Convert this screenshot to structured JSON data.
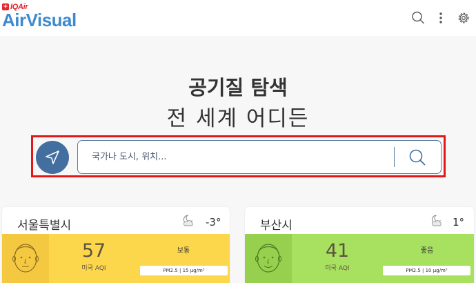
{
  "app": {
    "brand_small": "IQAir",
    "brand_badge": "+",
    "brand_main": "AirVisual"
  },
  "header_icons": [
    "search-icon",
    "more-vertical-icon",
    "gear-icon"
  ],
  "hero": {
    "title": "공기질 탐색",
    "subtitle": "전 세계 어디든"
  },
  "search": {
    "placeholder": "국가나 도시, 위치...",
    "value": ""
  },
  "colors": {
    "brand_blue": "#3d8ad0",
    "location_button": "#436ea0",
    "highlight": "#e01818",
    "moderate": "#fdd74b",
    "good": "#a8e05f"
  },
  "cities": [
    {
      "name": "서울특별시",
      "temp": "-3°",
      "weather_icon": "moon-cloud-icon",
      "aqi": "57",
      "aqi_label": "미국 AQI",
      "status": "보통",
      "pm": "PM2.5 | 15 µg/m³"
    },
    {
      "name": "부산시",
      "temp": "1°",
      "weather_icon": "moon-cloud-icon",
      "aqi": "41",
      "aqi_label": "미국 AQI",
      "status": "좋음",
      "pm": "PM2.5 | 10 µg/m³"
    }
  ]
}
